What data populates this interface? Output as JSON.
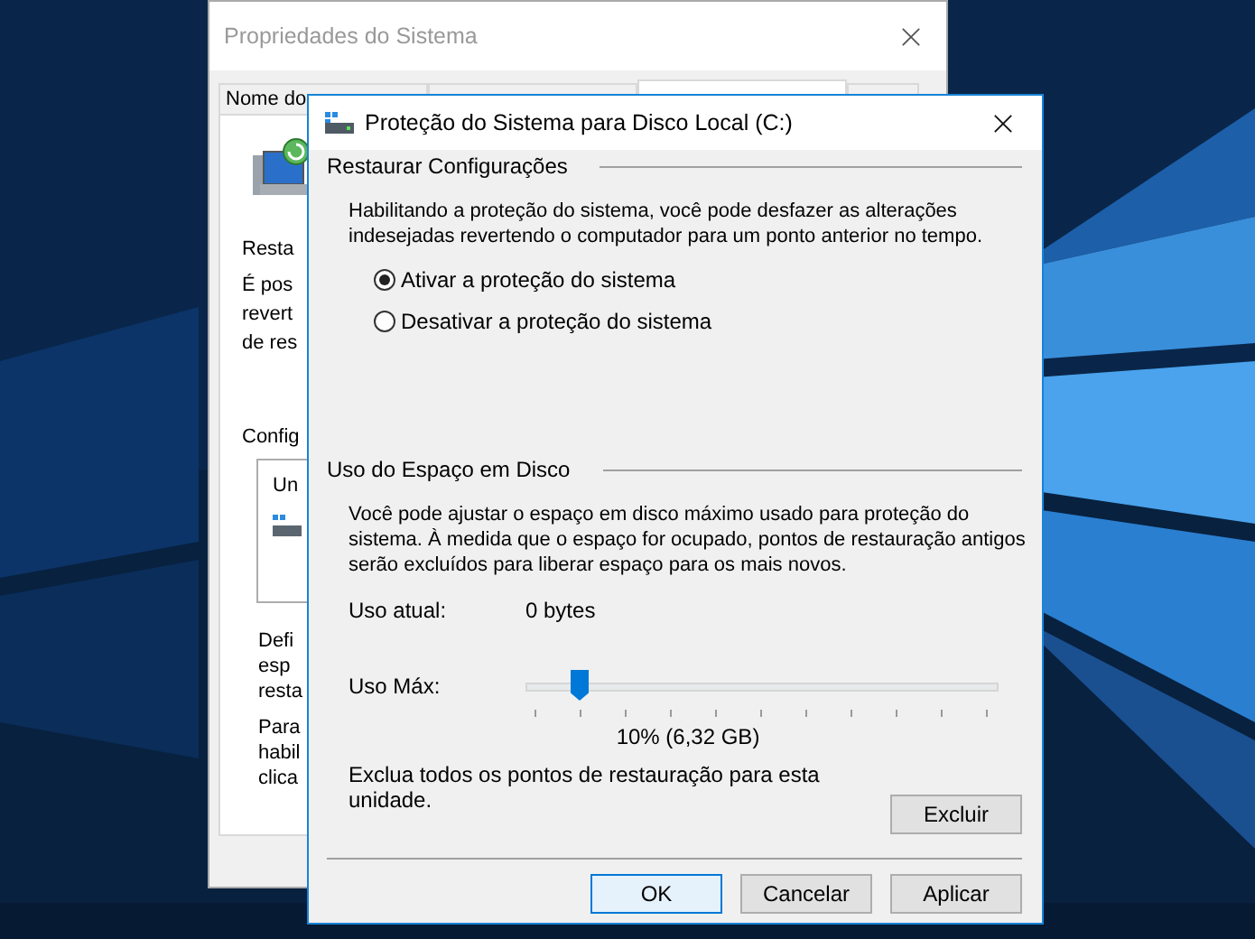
{
  "background_window": {
    "title": "Propriedades do Sistema",
    "tabs": [
      {
        "label": "Nome do",
        "selected": false
      },
      {
        "selected": false
      },
      {
        "selected": true
      },
      {
        "selected": false
      }
    ],
    "section_label": "Resta",
    "intro_lines": [
      "É pos",
      "revert",
      "de res"
    ],
    "config_label": "Config",
    "drive_list": [
      "Un"
    ],
    "define_lines": [
      "Defi",
      "esp",
      "resta"
    ],
    "enable_lines": [
      "Para",
      "habil",
      "clica"
    ]
  },
  "dialog": {
    "title": "Proteção do Sistema para Disco Local (C:)",
    "restore_group": {
      "heading": "Restaurar Configurações",
      "description": [
        "Habilitando a proteção do sistema, você pode desfazer as alterações",
        "indesejadas revertendo o computador para um ponto anterior no tempo."
      ],
      "options": [
        {
          "label": "Ativar a proteção do sistema",
          "selected": true
        },
        {
          "label": "Desativar a proteção do sistema",
          "selected": false
        }
      ]
    },
    "disk_group": {
      "heading": "Uso do Espaço em Disco",
      "description": [
        "Você pode ajustar o espaço em disco máximo usado para proteção do",
        "sistema. À medida que o espaço for ocupado, pontos de restauração antigos",
        "serão excluídos para liberar espaço para os mais novos."
      ],
      "current_label": "Uso atual:",
      "current_value": "0 bytes",
      "max_label": "Uso Máx:",
      "max_slider": {
        "level": 0.1
      },
      "max_reading": "10% (6,32 GB)",
      "delete_text": [
        "Exclua todos os pontos de restauração para esta",
        "unidade."
      ],
      "delete_button": "Excluir"
    },
    "buttons": [
      {
        "label": "OK",
        "default": true
      },
      {
        "label": "Cancelar",
        "default": false
      },
      {
        "label": "Aplicar",
        "default": false
      }
    ]
  }
}
